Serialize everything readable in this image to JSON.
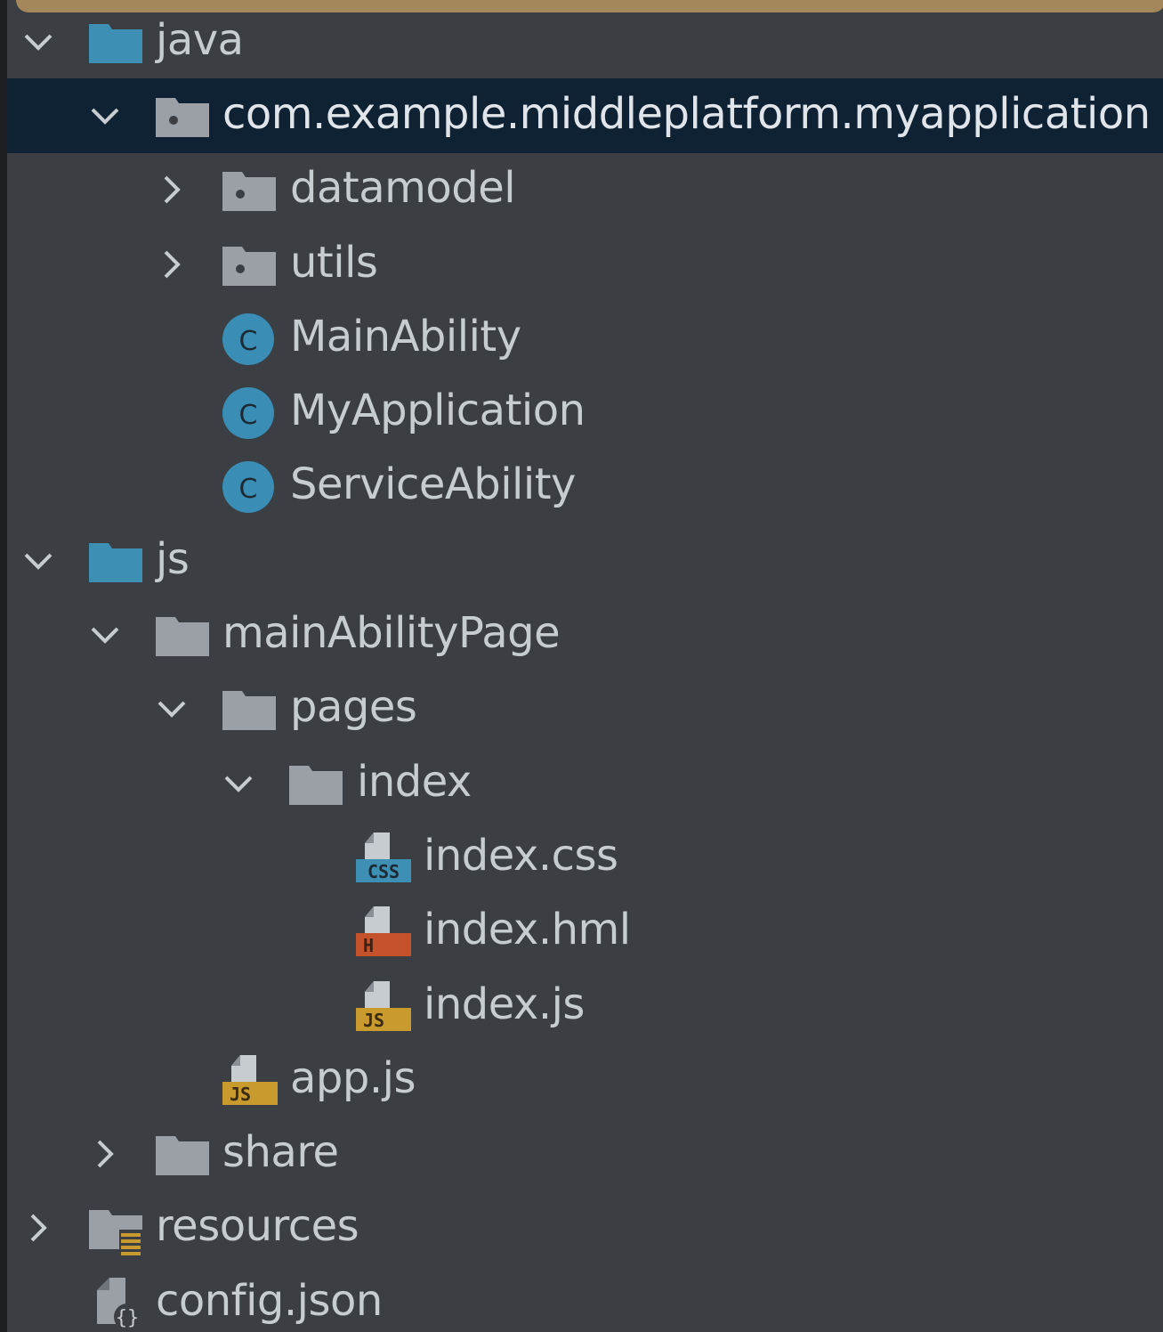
{
  "tree": {
    "items": [
      {
        "label": "java",
        "icon": "source-folder-icon",
        "expanded": true
      },
      {
        "label": "com.example.middleplatform.myapplication",
        "icon": "package-icon",
        "expanded": true,
        "selected": true
      },
      {
        "label": "datamodel",
        "icon": "package-icon",
        "expanded": false
      },
      {
        "label": "utils",
        "icon": "package-icon",
        "expanded": false
      },
      {
        "label": "MainAbility",
        "icon": "java-class-icon"
      },
      {
        "label": "MyApplication",
        "icon": "java-class-icon"
      },
      {
        "label": "ServiceAbility",
        "icon": "java-class-icon"
      },
      {
        "label": "js",
        "icon": "source-folder-icon",
        "expanded": true
      },
      {
        "label": "mainAbilityPage",
        "icon": "folder-icon",
        "expanded": true
      },
      {
        "label": "pages",
        "icon": "folder-icon",
        "expanded": true
      },
      {
        "label": "index",
        "icon": "folder-icon",
        "expanded": true
      },
      {
        "label": "index.css",
        "icon": "css-file-icon"
      },
      {
        "label": "index.hml",
        "icon": "hml-file-icon"
      },
      {
        "label": "index.js",
        "icon": "js-file-icon"
      },
      {
        "label": "app.js",
        "icon": "js-file-icon"
      },
      {
        "label": "share",
        "icon": "folder-icon",
        "expanded": false
      },
      {
        "label": "resources",
        "icon": "resources-folder-icon",
        "expanded": false
      },
      {
        "label": "config.json",
        "icon": "json-file-icon"
      }
    ]
  },
  "colors": {
    "background": "#3b3f43",
    "selection": "#0f2234",
    "text": "#c7ccd1",
    "accent_bar": "#a4885c",
    "source_folder": "#3d8fb4",
    "folder": "#9aa0a6",
    "class_icon": "#3a8db5",
    "css_badge": "#3d8fb4",
    "hml_badge": "#c4522a",
    "js_badge": "#c99a2e"
  },
  "badges": {
    "css": "CSS",
    "hml": "H",
    "js": "JS",
    "class": "C"
  }
}
